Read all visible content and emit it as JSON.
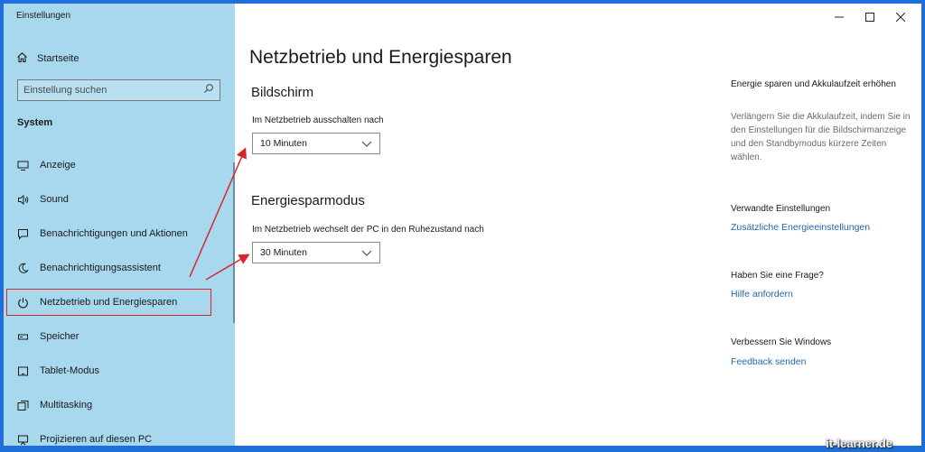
{
  "window": {
    "title": "Einstellungen"
  },
  "sidebar": {
    "home_label": "Startseite",
    "search_placeholder": "Einstellung suchen",
    "section_title": "System",
    "items": [
      {
        "label": "Anzeige",
        "icon": "monitor-icon"
      },
      {
        "label": "Sound",
        "icon": "speaker-icon"
      },
      {
        "label": "Benachrichtigungen und Aktionen",
        "icon": "notification-icon"
      },
      {
        "label": "Benachrichtigungsassistent",
        "icon": "moon-icon"
      },
      {
        "label": "Netzbetrieb und Energiesparen",
        "icon": "power-icon",
        "selected": true
      },
      {
        "label": "Speicher",
        "icon": "storage-icon"
      },
      {
        "label": "Tablet-Modus",
        "icon": "tablet-icon"
      },
      {
        "label": "Multitasking",
        "icon": "multitasking-icon"
      },
      {
        "label": "Projizieren auf diesen PC",
        "icon": "project-icon"
      }
    ]
  },
  "main": {
    "title": "Netzbetrieb und Energiesparen",
    "screen": {
      "heading": "Bildschirm",
      "label": "Im Netzbetrieb ausschalten nach",
      "value": "10 Minuten"
    },
    "sleep": {
      "heading": "Energiesparmodus",
      "label": "Im Netzbetrieb wechselt der PC in den Ruhezustand nach",
      "value": "30 Minuten"
    }
  },
  "right": {
    "battery_heading": "Energie sparen und Akkulaufzeit erhöhen",
    "battery_text": "Verlängern Sie die Akkulaufzeit, indem Sie in den Einstellungen für die Bildschirmanzeige und den Standbymodus kürzere Zeiten wählen.",
    "related_heading": "Verwandte Einstellungen",
    "related_link": "Zusätzliche Energieeinstellungen",
    "question_heading": "Haben Sie eine Frage?",
    "question_link": "Hilfe anfordern",
    "improve_heading": "Verbessern Sie Windows",
    "improve_link": "Feedback senden"
  },
  "watermark": "it-learner.de",
  "colors": {
    "sidebar_bg": "#a8d8ee",
    "link": "#1f67b1",
    "highlight": "#d7262e",
    "desktop": "#1e6fd9"
  }
}
